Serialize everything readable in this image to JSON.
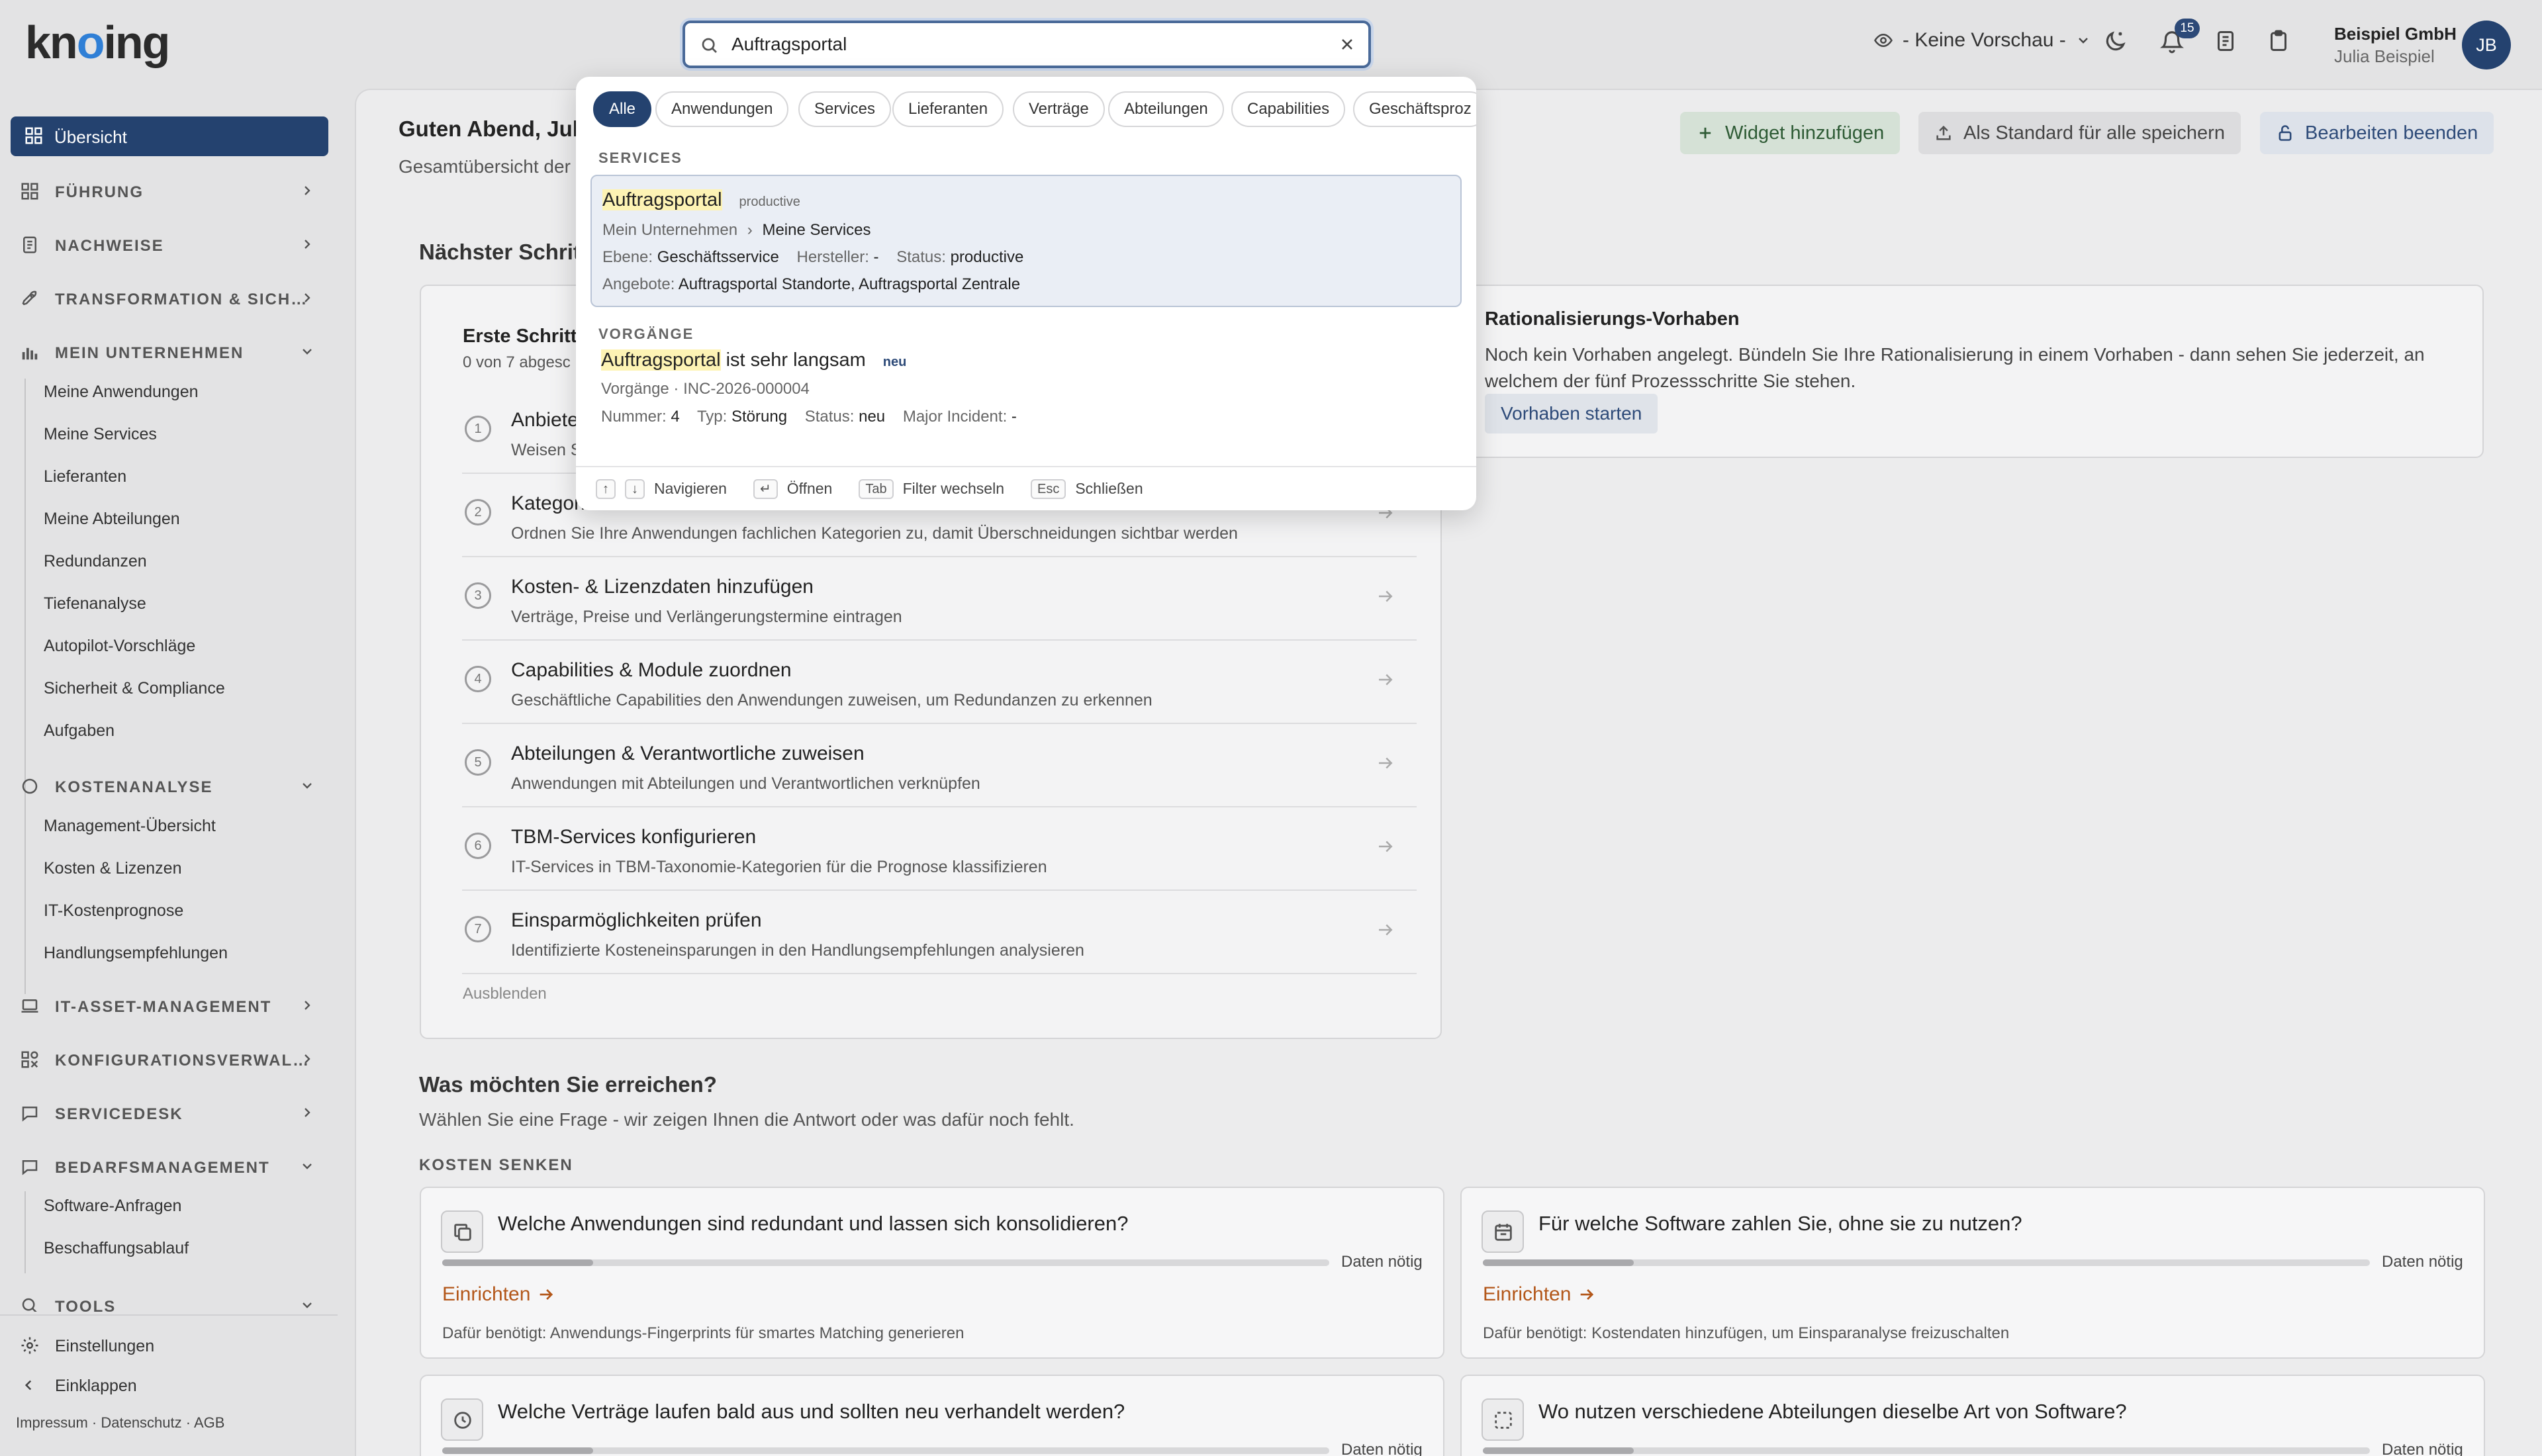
{
  "app": {
    "logo": "knoing",
    "accent": "#24426f"
  },
  "search": {
    "value": "Auftragsportal",
    "placeholder": ""
  },
  "header": {
    "preview": "- Keine Vorschau -",
    "notification_count": "15",
    "company": "Beispiel GmbH",
    "user": "Julia Beispiel",
    "avatar_initials": "JB"
  },
  "sidebar": {
    "active": "Übersicht",
    "sections": [
      {
        "label": "FÜHRUNG",
        "icon": "grid-icon"
      },
      {
        "label": "NACHWEISE",
        "icon": "document-icon"
      },
      {
        "label": "TRANSFORMATION & SICH…",
        "icon": "rocket-icon"
      },
      {
        "label": "MEIN UNTERNEHMEN",
        "icon": "chart-icon"
      },
      {
        "label": "KOSTENANALYSE",
        "icon": "circle-icon"
      },
      {
        "label": "IT-ASSET-MANAGEMENT",
        "icon": "laptop-icon"
      },
      {
        "label": "KONFIGURATIONSVERWAL…",
        "icon": "config-icon"
      },
      {
        "label": "SERVICEDESK",
        "icon": "chat-icon"
      },
      {
        "label": "BEDARFSMANAGEMENT",
        "icon": "chat-icon"
      },
      {
        "label": "TOOLS",
        "icon": "search-icon"
      }
    ],
    "mein_unternehmen": [
      "Meine Anwendungen",
      "Meine Services",
      "Lieferanten",
      "Meine Abteilungen",
      "Redundanzen",
      "Tiefenanalyse",
      "Autopilot-Vorschläge",
      "Sicherheit & Compliance",
      "Aufgaben"
    ],
    "kostenanalyse": [
      "Management-Übersicht",
      "Kosten & Lizenzen",
      "IT-Kostenprognose",
      "Handlungsempfehlungen"
    ],
    "bedarfsmanagement": [
      "Software-Anfragen",
      "Beschaffungsablauf"
    ],
    "settings": "Einstellungen",
    "collapse": "Einklappen",
    "legal": "Impressum · Datenschutz · AGB"
  },
  "main": {
    "greeting": "Guten Abend, Julia",
    "subtitle": "Gesamtübersicht der",
    "buttons": {
      "add_widget": "Widget hinzufügen",
      "save_default": "Als Standard für alle speichern",
      "end_edit": "Bearbeiten beenden"
    },
    "next_steps_title": "Nächster Schrit",
    "first_steps": {
      "title": "Erste Schritt",
      "progress": "0 von 7 abgesc"
    },
    "steps": [
      {
        "num": "1",
        "title": "Anbiete",
        "desc": "Weisen S"
      },
      {
        "num": "2",
        "title": "Kategori",
        "desc": "Ordnen Sie Ihre Anwendungen fachlichen Kategorien zu, damit Überschneidungen sichtbar werden"
      },
      {
        "num": "3",
        "title": "Kosten- & Lizenzdaten hinzufügen",
        "desc": "Verträge, Preise und Verlängerungstermine eintragen"
      },
      {
        "num": "4",
        "title": "Capabilities & Module zuordnen",
        "desc": "Geschäftliche Capabilities den Anwendungen zuweisen, um Redundanzen zu erkennen"
      },
      {
        "num": "5",
        "title": "Abteilungen & Verantwortliche zuweisen",
        "desc": "Anwendungen mit Abteilungen und Verantwortlichen verknüpfen"
      },
      {
        "num": "6",
        "title": "TBM-Services konfigurieren",
        "desc": "IT-Services in TBM-Taxonomie-Kategorien für die Prognose klassifizieren"
      },
      {
        "num": "7",
        "title": "Einsparmöglichkeiten prüfen",
        "desc": "Identifizierte Kosteneinsparungen in den Handlungsempfehlungen analysieren"
      }
    ],
    "hide": "Ausblenden",
    "ratio": {
      "title": "Rationalisierungs-Vorhaben",
      "text1": "Noch kein Vorhaben angelegt. Bündeln Sie Ihre Rationalisierung in einem Vorhaben - dann sehen Sie jederzeit, an",
      "text2": "welchem der fünf Prozessschritte Sie stehen.",
      "button": "Vorhaben starten"
    },
    "goals_title": "Was möchten Sie erreichen?",
    "goals_sub": "Wählen Sie eine Frage - wir zeigen Ihnen die Antwort oder was dafür noch fehlt.",
    "cost_label": "KOSTEN SENKEN",
    "questions": [
      {
        "title": "Welche Anwendungen sind redundant und lassen sich konsolidieren?",
        "need": "Daten nötig",
        "setup": "Einrichten",
        "desc": "Dafür benötigt: Anwendungs-Fingerprints für smartes Matching generieren",
        "progress": 0.17
      },
      {
        "title": "Für welche Software zahlen Sie, ohne sie zu nutzen?",
        "need": "Daten nötig",
        "setup": "Einrichten",
        "desc": "Dafür benötigt: Kostendaten hinzufügen, um Einsparanalyse freizuschalten",
        "progress": 0.17
      },
      {
        "title": "Welche Verträge laufen bald aus und sollten neu verhandelt werden?",
        "need": "Daten nötig"
      },
      {
        "title": "Wo nutzen verschiedene Abteilungen dieselbe Art von Software?",
        "need": "Daten nötig"
      }
    ]
  },
  "dropdown": {
    "filters": [
      "Alle",
      "Anwendungen",
      "Services",
      "Lieferanten",
      "Verträge",
      "Abteilungen",
      "Capabilities",
      "Geschäftsproz"
    ],
    "services_label": "SERVICES",
    "service": {
      "name": "Auftragsportal",
      "status_tag": "productive",
      "path1": "Mein Unternehmen",
      "path2": "Meine Services",
      "level_label": "Ebene:",
      "level": "Geschäftsservice",
      "vendor_label": "Hersteller:",
      "vendor": "-",
      "status_label": "Status:",
      "status": "productive",
      "offers_label": "Angebote:",
      "offers": "Auftragsportal Standorte, Auftragsportal Zentrale"
    },
    "incidents_label": "VORGÄNGE",
    "incident": {
      "name_hl": "Auftragsportal",
      "name_rest": " ist sehr langsam",
      "tag": "neu",
      "ref": "Vorgänge · INC-2026-000004",
      "num_label": "Nummer:",
      "num": "4",
      "type_label": "Typ:",
      "type": "Störung",
      "status_label": "Status:",
      "status": "neu",
      "major_label": "Major Incident:",
      "major": "-"
    },
    "footer": {
      "navigate": "Navigieren",
      "open": "Öffnen",
      "tab": "Tab",
      "switch": "Filter wechseln",
      "esc": "Esc",
      "close": "Schließen"
    }
  }
}
